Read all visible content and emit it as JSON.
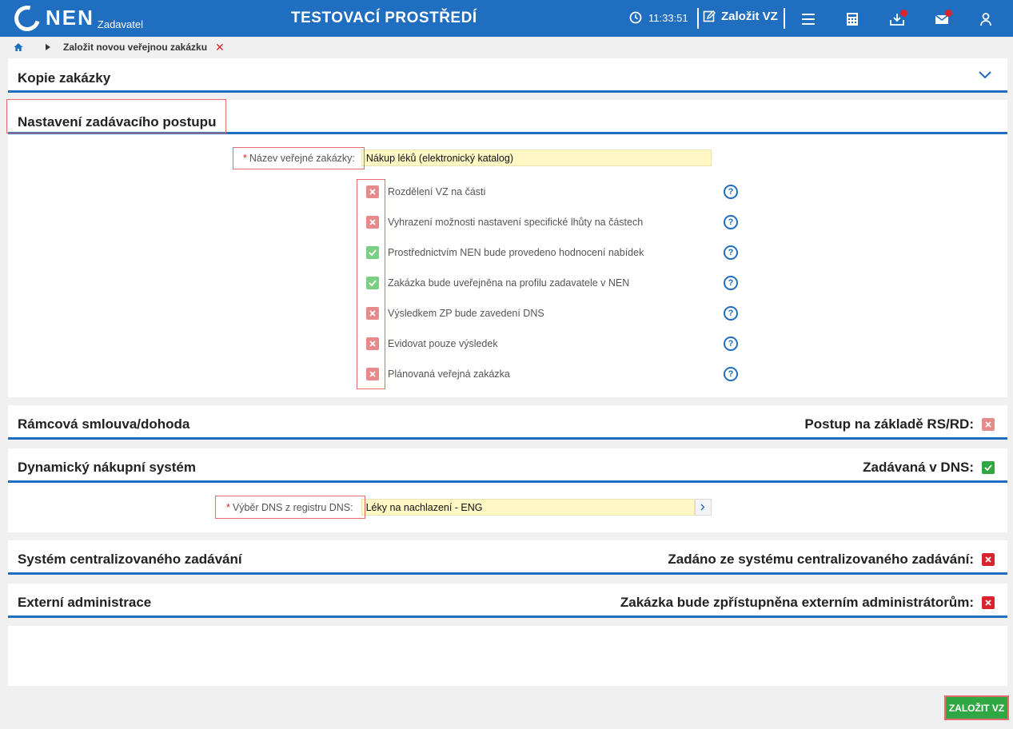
{
  "header": {
    "logo_text": "NEN",
    "logo_sub": "Zadavatel",
    "env_title": "TESTOVACÍ PROSTŘEDÍ",
    "time": "11:33:51",
    "create_label": "Založit VZ"
  },
  "breadcrumb": {
    "current": "Založit novou veřejnou zakázku"
  },
  "copy_panel": {
    "title": "Kopie zakázky"
  },
  "setup_panel": {
    "title": "Nastavení zadávacího postupu",
    "name_label": "Název veřejné zakázky:",
    "name_value": "Nákup léků (elektronický katalog)",
    "options": [
      {
        "label": "Rozdělení VZ na části",
        "checked": false
      },
      {
        "label": "Vyhrazení možnosti nastavení specifické lhůty na částech",
        "checked": false
      },
      {
        "label": "Prostřednictvím NEN bude provedeno hodnocení nabídek",
        "checked": true
      },
      {
        "label": "Zakázka bude uveřejněna na profilu zadavatele v NEN",
        "checked": true
      },
      {
        "label": "Výsledkem ZP bude zavedení DNS",
        "checked": false
      },
      {
        "label": "Evidovat pouze výsledek",
        "checked": false
      },
      {
        "label": "Plánovaná veřejná zakázka",
        "checked": false
      }
    ],
    "help_glyph": "?"
  },
  "framework_panel": {
    "title": "Rámcová smlouva/dohoda",
    "right_label": "Postup na základě RS/RD:",
    "checked": false
  },
  "dns_panel": {
    "title": "Dynamický nákupní systém",
    "right_label": "Zadávaná v DNS:",
    "checked": true,
    "select_label": "Výběr DNS z registru DNS:",
    "select_value": "Léky na nachlazení - ENG"
  },
  "central_panel": {
    "title": "Systém centralizovaného zadávání",
    "right_label": "Zadáno ze systému centralizovaného zadávání:",
    "checked": false
  },
  "external_panel": {
    "title": "Externí administrace",
    "right_label": "Zakázka bude zpřístupněna externím administrátorům:",
    "checked": false
  },
  "submit_label": "ZALOŽIT VZ",
  "colors": {
    "brand": "#1f6ebf",
    "check_yes": "#7bcf85",
    "check_no": "#e58b8b",
    "submit": "#2fa742"
  }
}
